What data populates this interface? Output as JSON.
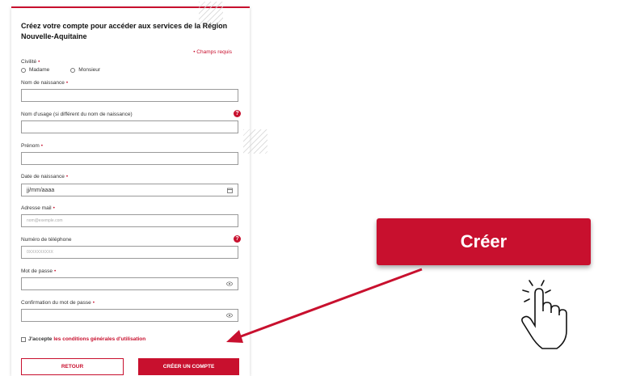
{
  "form": {
    "title": "Créez votre compte pour accéder aux services de la Région Nouvelle-Aquitaine",
    "required_note": "• Champs requis",
    "civility": {
      "label": "Civilité",
      "options": [
        "Madame",
        "Monsieur"
      ]
    },
    "fields": {
      "birth_name": {
        "label": "Nom de naissance",
        "value": ""
      },
      "usage_name": {
        "label": "Nom d'usage (si différent du nom de naissance)",
        "value": ""
      },
      "first_name": {
        "label": "Prénom",
        "value": ""
      },
      "birth_date": {
        "label": "Date de naissance",
        "placeholder": "jj/mm/aaaa"
      },
      "email": {
        "label": "Adresse mail",
        "placeholder": "nom@exemple.com"
      },
      "phone": {
        "label": "Numéro de téléphone",
        "placeholder": "0XXXXXXXXX"
      },
      "password": {
        "label": "Mot de passe",
        "value": ""
      },
      "password_confirm": {
        "label": "Confirmation du mot de passe",
        "value": ""
      }
    },
    "required_star": "•",
    "help_glyph": "?",
    "terms": {
      "prefix": "J'accepte",
      "link": "les conditions générales d'utilisation"
    },
    "buttons": {
      "back": "RETOUR",
      "create": "CRÉER UN COMPTE"
    }
  },
  "callout": {
    "button_label": "Créer",
    "accent_color": "#c8102e"
  },
  "icons": [
    "calendar-icon",
    "eye-icon",
    "help-icon",
    "pointing-hand-icon",
    "arrow-icon"
  ]
}
